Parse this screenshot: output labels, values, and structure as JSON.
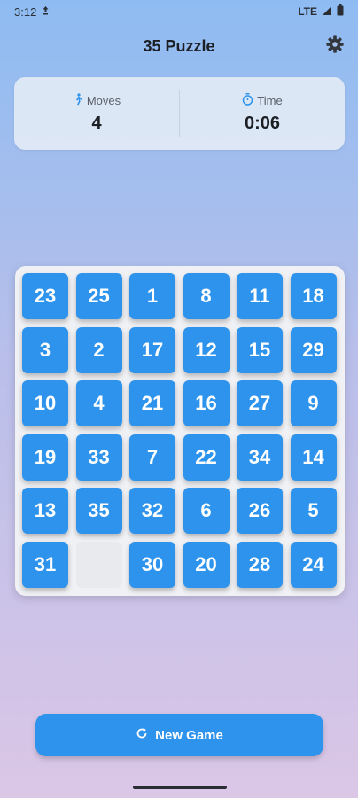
{
  "status_bar": {
    "time": "3:12",
    "network": "LTE"
  },
  "app_bar": {
    "title": "35 Puzzle",
    "settings_icon": "gear-icon"
  },
  "stats": {
    "moves_label": "Moves",
    "moves_value": "4",
    "moves_icon": "walking-person-icon",
    "time_label": "Time",
    "time_value": "0:06",
    "time_icon": "stopwatch-icon"
  },
  "board": {
    "rows": [
      [
        "23",
        "25",
        "1",
        "8",
        "11",
        "18"
      ],
      [
        "3",
        "2",
        "17",
        "12",
        "15",
        "29"
      ],
      [
        "10",
        "4",
        "21",
        "16",
        "27",
        "9"
      ],
      [
        "19",
        "33",
        "7",
        "22",
        "34",
        "14"
      ],
      [
        "13",
        "35",
        "32",
        "6",
        "26",
        "5"
      ],
      [
        "31",
        "",
        "30",
        "20",
        "28",
        "24"
      ]
    ]
  },
  "new_game": {
    "label": "New Game",
    "icon": "refresh-icon"
  },
  "colors": {
    "tile": "#2d93ec",
    "tile_text": "#ffffff",
    "empty_tile": "#e9eaee",
    "board": "#f0f1f4",
    "button": "#2d93ec"
  }
}
